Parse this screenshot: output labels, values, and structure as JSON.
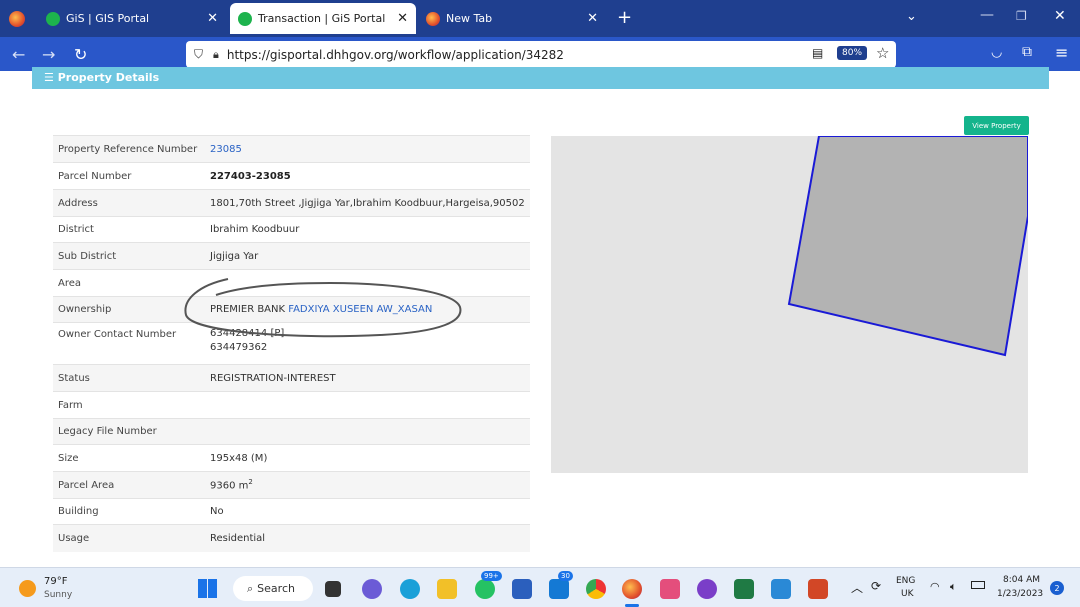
{
  "browser": {
    "tabs": [
      {
        "title": "GiS | GIS Portal",
        "active": false
      },
      {
        "title": "Transaction | GiS Portal",
        "active": true
      },
      {
        "title": "New Tab",
        "active": false
      }
    ],
    "url": "https://gisportal.dhhgov.org/workflow/application/34282",
    "zoom": "80%",
    "new_tab": "+"
  },
  "section": {
    "title": "Property Details"
  },
  "view_property_label": "View Property",
  "property": [
    {
      "label": "Property Reference Number",
      "value": "23085",
      "style": "link"
    },
    {
      "label": "Parcel Number",
      "value": "227403-23085",
      "style": "bold"
    },
    {
      "label": "Address",
      "value": "1801,70th Street ,Jigjiga Yar,Ibrahim Koodbuur,Hargeisa,90502",
      "style": "normal"
    },
    {
      "label": "District",
      "value": "Ibrahim Koodbuur",
      "style": "normal"
    },
    {
      "label": "Sub District",
      "value": "Jigjiga Yar",
      "style": "normal"
    },
    {
      "label": "Area",
      "value": "",
      "style": "normal"
    },
    {
      "label": "Ownership",
      "value_prefix": "PREMIER BANK",
      "value": "FADXIYA XUSEEN AW_XASAN",
      "style": "mixed"
    },
    {
      "label": "Owner Contact Number",
      "value": "634428414 [P]",
      "value2": "634479362",
      "style": "normal"
    },
    {
      "label": "Status",
      "value": "REGISTRATION-INTEREST",
      "style": "normal"
    },
    {
      "label": "Farm",
      "value": "",
      "style": "normal"
    },
    {
      "label": "Legacy File Number",
      "value": "",
      "style": "normal"
    },
    {
      "label": "Size",
      "value": "195x48 (M)",
      "style": "normal"
    },
    {
      "label": "Parcel Area",
      "value": "9360 m",
      "unit_sup": "2",
      "style": "normal"
    },
    {
      "label": "Building",
      "value": "No",
      "style": "normal"
    },
    {
      "label": "Usage",
      "value": "Residential",
      "style": "normal"
    }
  ],
  "taskbar": {
    "weather_temp": "79°F",
    "weather_desc": "Sunny",
    "search_label": "Search",
    "badge_99": "99+",
    "badge_30": "30",
    "lang": "ENG",
    "lang_region": "UK",
    "time": "8:04 AM",
    "date": "1/23/2023",
    "notifications": "2"
  },
  "colors": {
    "tabbar": "#1f3f8f",
    "navbar": "#2a57c9",
    "section_header": "#6ec6e0",
    "view_button": "#14b48c",
    "parcel_fill": "#b3b3b3",
    "parcel_stroke": "#1a1ad6",
    "link": "#2a63c5"
  }
}
